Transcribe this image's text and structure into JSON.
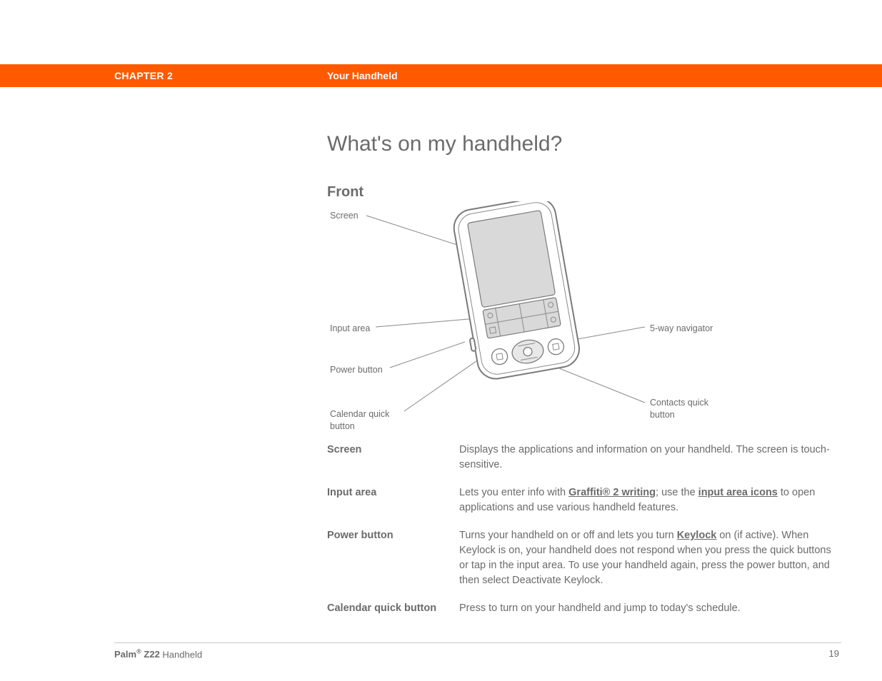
{
  "header": {
    "chapter": "CHAPTER 2",
    "subtitle": "Your Handheld"
  },
  "h1": "What's on my handheld?",
  "h2": "Front",
  "callouts": {
    "screen": "Screen",
    "input_area": "Input area",
    "power_button": "Power button",
    "calendar_quick": "Calendar quick button",
    "five_way": "5-way navigator",
    "contacts_quick": "Contacts quick button"
  },
  "defs": [
    {
      "term": "Screen",
      "parts": [
        {
          "t": "text",
          "v": "Displays the applications and information on your handheld. The screen is touch-sensitive."
        }
      ]
    },
    {
      "term": "Input area",
      "parts": [
        {
          "t": "text",
          "v": "Lets you enter info with "
        },
        {
          "t": "link",
          "v": "Graffiti® 2 writing"
        },
        {
          "t": "text",
          "v": "; use the "
        },
        {
          "t": "link",
          "v": "input area icons"
        },
        {
          "t": "text",
          "v": " to open applications and use various handheld features."
        }
      ]
    },
    {
      "term": "Power button",
      "parts": [
        {
          "t": "text",
          "v": "Turns your handheld on or off and lets you turn "
        },
        {
          "t": "link",
          "v": "Keylock"
        },
        {
          "t": "text",
          "v": " on (if active). When Keylock is on, your handheld does not respond when you press the quick buttons or tap in the input area. To use your handheld again, press the power button, and then select Deactivate Keylock."
        }
      ]
    },
    {
      "term": "Calendar quick button",
      "parts": [
        {
          "t": "text",
          "v": "Press to turn on your handheld and jump to today's schedule."
        }
      ]
    }
  ],
  "footer": {
    "brand_prefix": "Palm",
    "reg": "®",
    "model": " Z22",
    "suffix": " Handheld",
    "page": "19"
  }
}
